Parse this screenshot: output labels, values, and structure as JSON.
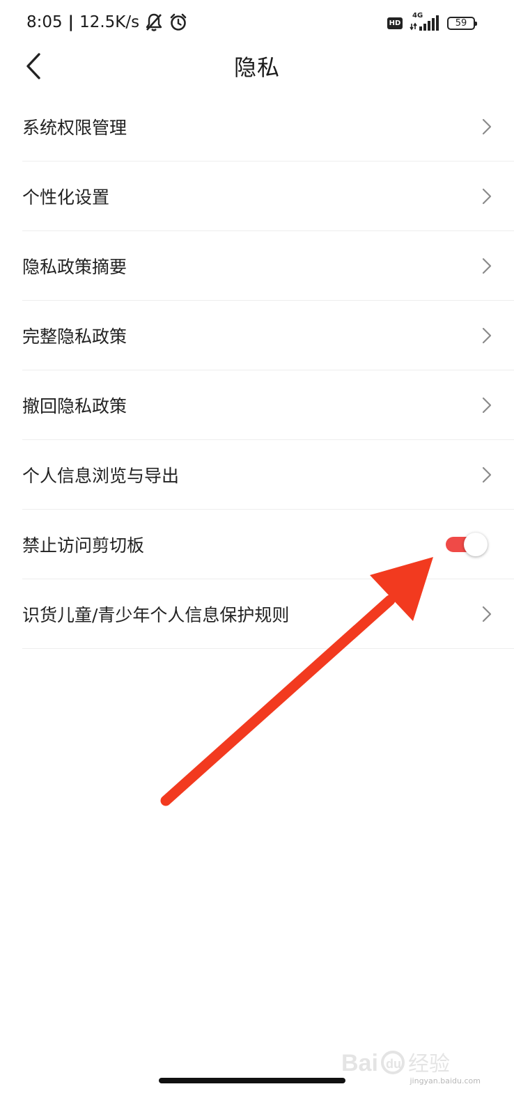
{
  "status_bar": {
    "time": "8:05",
    "speed": "12.5K/s",
    "network": "4G",
    "hd": "HD",
    "battery": "59",
    "icons": [
      "bell-off-icon",
      "alarm-icon",
      "signal-icon",
      "battery-icon"
    ]
  },
  "header": {
    "title": "隐私",
    "back_icon": "chevron-left-icon"
  },
  "list": {
    "items": [
      {
        "label": "系统权限管理",
        "type": "link"
      },
      {
        "label": "个性化设置",
        "type": "link"
      },
      {
        "label": "隐私政策摘要",
        "type": "link"
      },
      {
        "label": "完整隐私政策",
        "type": "link"
      },
      {
        "label": "撤回隐私政策",
        "type": "link"
      },
      {
        "label": "个人信息浏览与导出",
        "type": "link"
      },
      {
        "label": "禁止访问剪切板",
        "type": "toggle",
        "on": true
      },
      {
        "label": "识货儿童/青少年个人信息保护规则",
        "type": "link"
      }
    ]
  },
  "colors": {
    "accent": "#ef4a47",
    "arrow": "#f23a1f",
    "text": "#222222",
    "divider": "#eeeeee"
  },
  "watermark": {
    "logo": "Bai du 经验",
    "url": "jingyan.baidu.com"
  }
}
